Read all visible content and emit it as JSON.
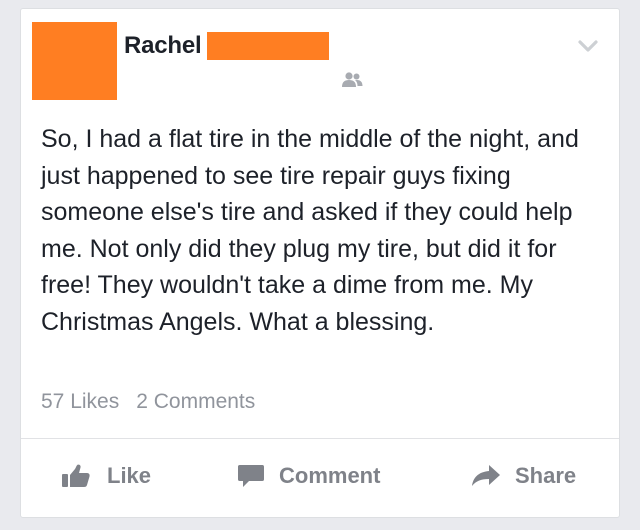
{
  "post": {
    "author_first_name": "Rachel",
    "body": "So, I had a flat tire in the middle of the night, and just happened to see tire repair guys fixing someone else's tire and asked if they could help me. Not only did they plug my tire, but did it for free! They wouldn't take a dime from me. My Christmas Angels. What a blessing.",
    "likes_label": "57 Likes",
    "comments_label": "2 Comments"
  },
  "actions": {
    "like_label": "Like",
    "comment_label": "Comment",
    "share_label": "Share"
  },
  "icons": {
    "options": "chevron-down-icon",
    "audience": "friends-icon",
    "like": "thumbs-up-icon",
    "comment": "speech-bubble-icon",
    "share": "share-arrow-icon"
  },
  "colors": {
    "redaction": "#ff7e22",
    "background": "#e9eaee",
    "card": "#ffffff",
    "text": "#1d2129",
    "muted": "#90949c",
    "action": "#7f8289"
  }
}
